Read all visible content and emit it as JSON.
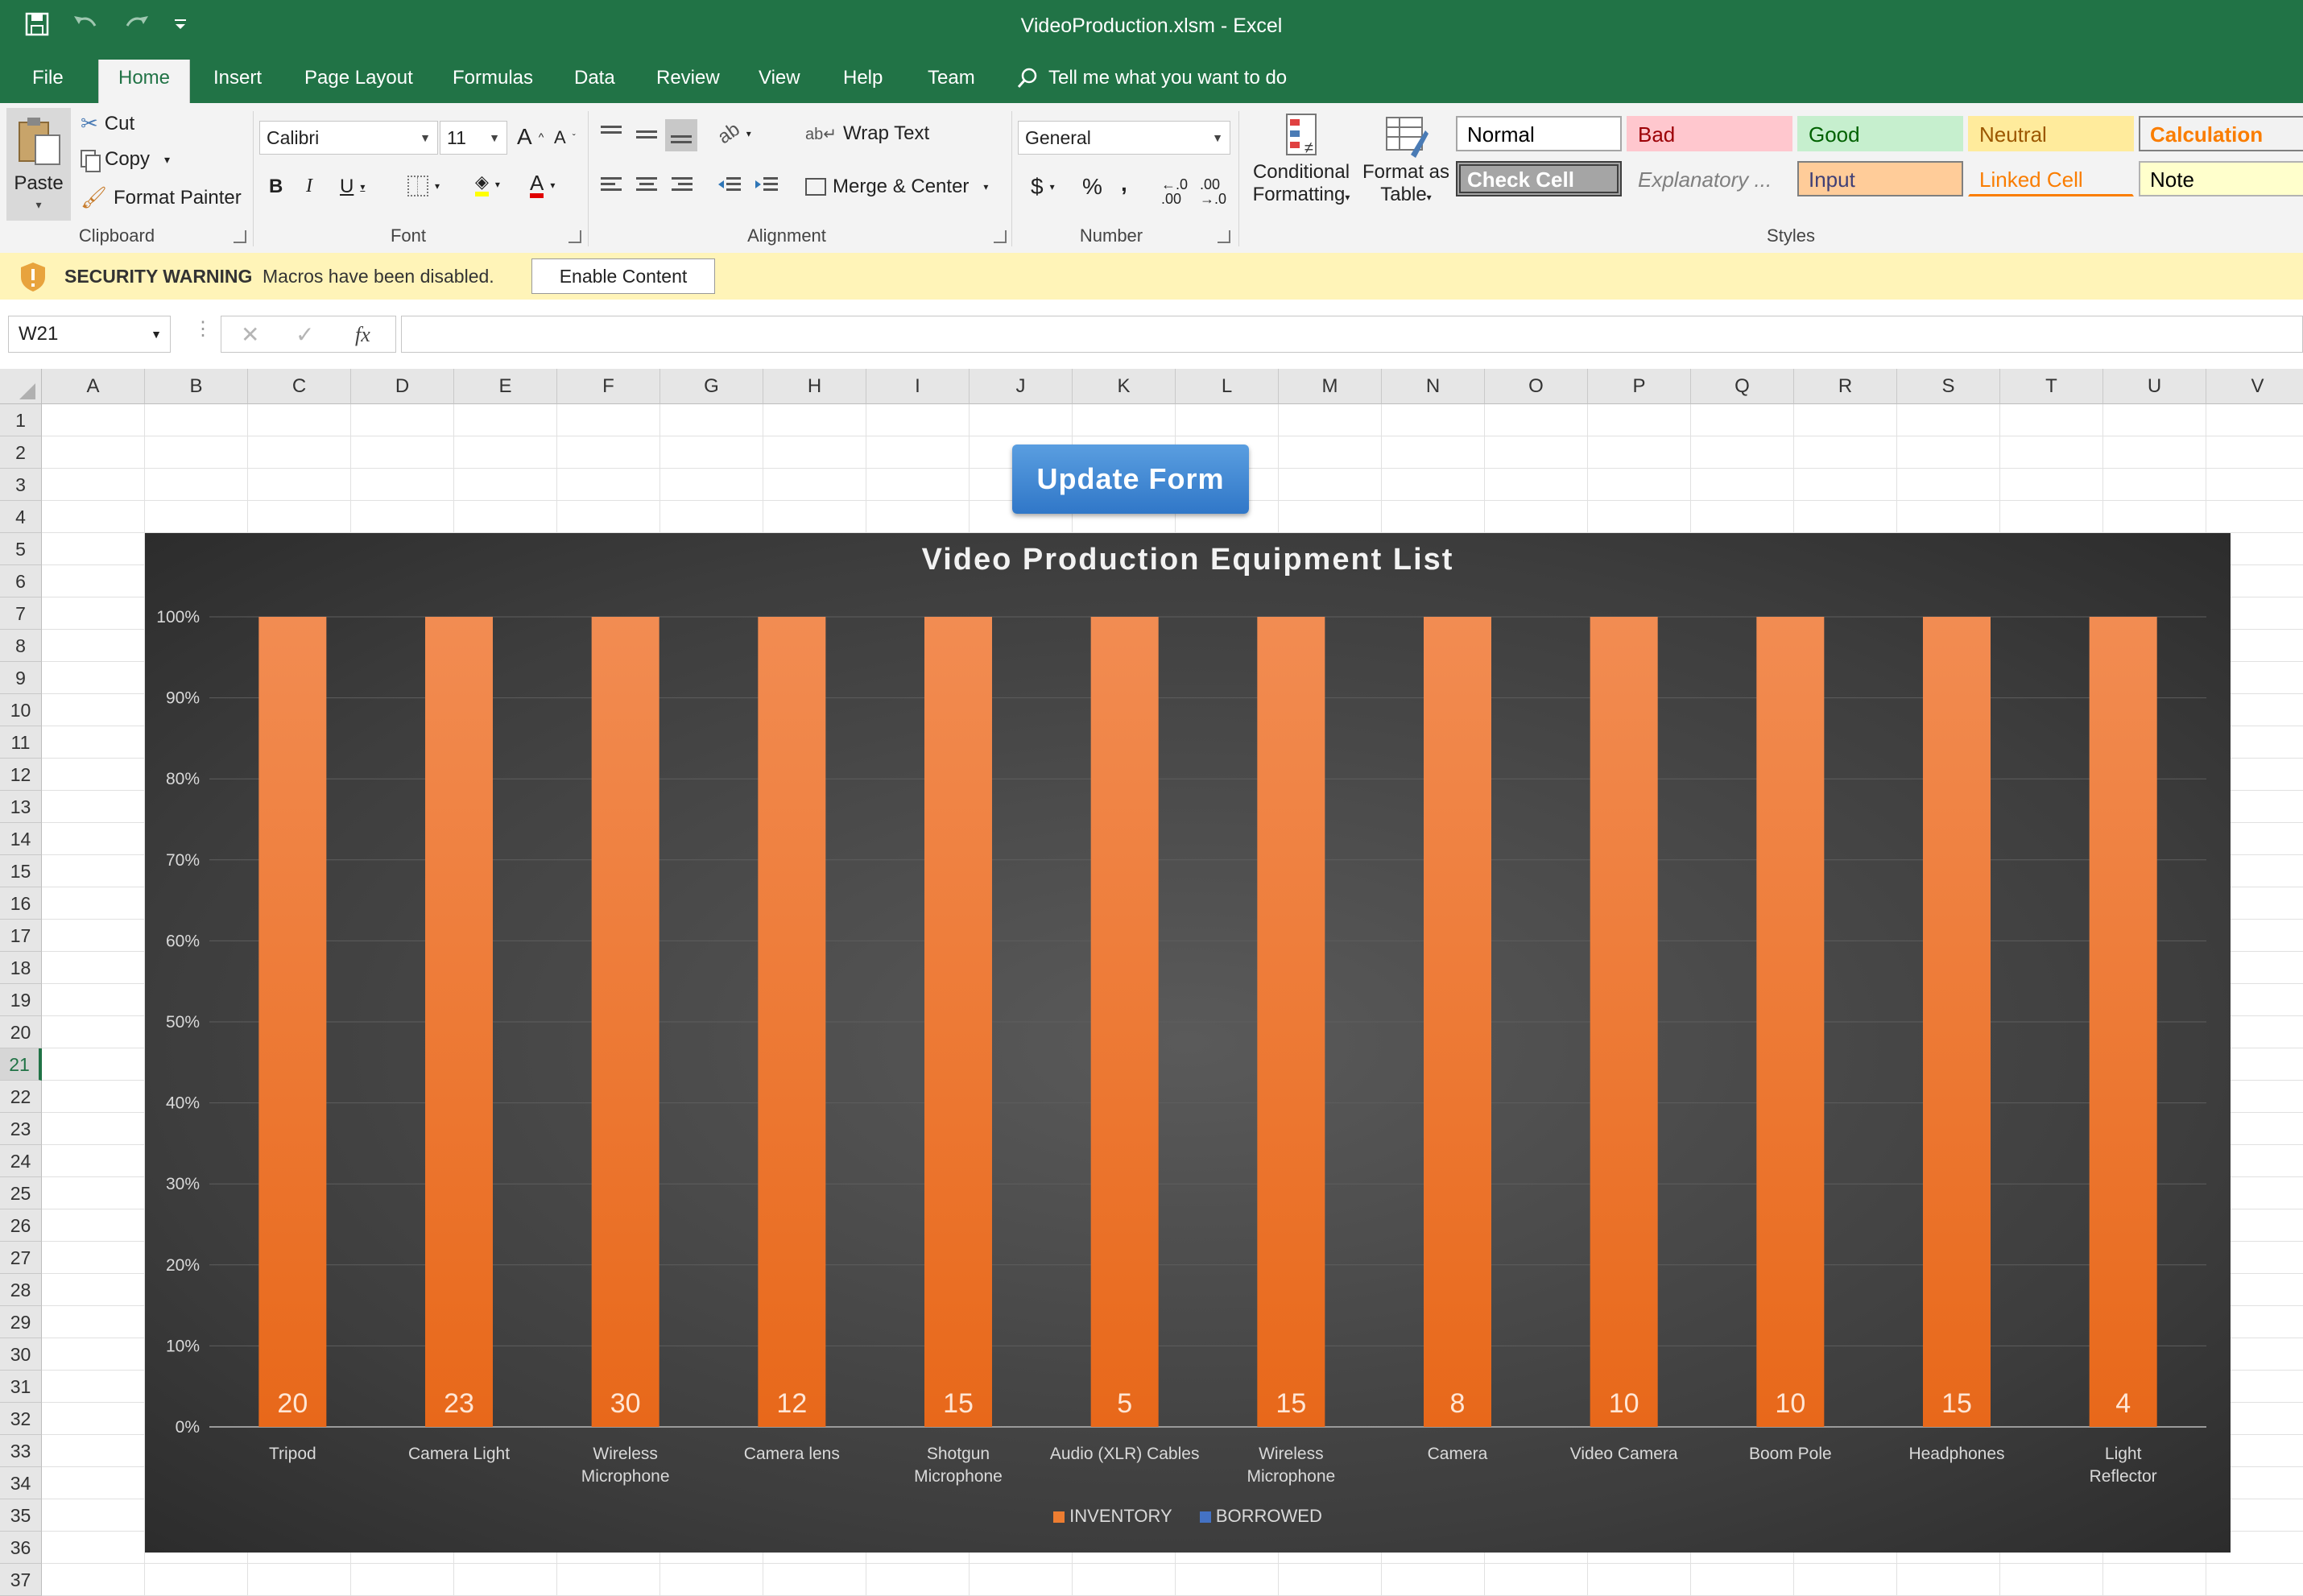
{
  "window": {
    "title": "VideoProduction.xlsm  -  Excel"
  },
  "tabs": [
    "File",
    "Home",
    "Insert",
    "Page Layout",
    "Formulas",
    "Data",
    "Review",
    "View",
    "Help",
    "Team"
  ],
  "tell_me": "Tell me what you want to do",
  "clipboard": {
    "paste": "Paste",
    "cut": "Cut",
    "copy": "Copy",
    "format_painter": "Format Painter",
    "label": "Clipboard"
  },
  "font": {
    "name": "Calibri",
    "size": "11",
    "label": "Font"
  },
  "alignment": {
    "wrap_text": "Wrap Text",
    "merge_center": "Merge & Center",
    "label": "Alignment"
  },
  "number": {
    "format": "General",
    "label": "Number"
  },
  "styles": {
    "conditional": "Conditional",
    "formatting": "Formatting",
    "format_as": "Format as",
    "table": "Table",
    "label": "Styles",
    "cells": [
      {
        "text": "Normal",
        "bg": "#ffffff",
        "color": "#000000",
        "border": "#a6a6a6"
      },
      {
        "text": "Bad",
        "bg": "#ffc7ce",
        "color": "#9c0006",
        "border": "#ffc7ce"
      },
      {
        "text": "Good",
        "bg": "#c6efce",
        "color": "#006100",
        "border": "#c6efce"
      },
      {
        "text": "Neutral",
        "bg": "#ffeb9c",
        "color": "#9c5700",
        "border": "#ffeb9c"
      },
      {
        "text": "Calculation",
        "bg": "#f2f2f2",
        "color": "#fa7d00",
        "border": "#7f7f7f"
      },
      {
        "text": "Check Cell",
        "bg": "#a5a5a5",
        "color": "#ffffff",
        "border": "#3f3f3f"
      },
      {
        "text": "Explanatory ...",
        "bg": "#f3f3f3",
        "color": "#7f7f7f",
        "border": "#f3f3f3"
      },
      {
        "text": "Input",
        "bg": "#ffcc99",
        "color": "#3f3f76",
        "border": "#7f7f7f"
      },
      {
        "text": "Linked Cell",
        "bg": "#f3f3f3",
        "color": "#fa7d00",
        "border": "#f3f3f3"
      },
      {
        "text": "Note",
        "bg": "#ffffcc",
        "color": "#000000",
        "border": "#b2b2b2"
      }
    ]
  },
  "security": {
    "label": "SECURITY WARNING",
    "message": "Macros have been disabled.",
    "button": "Enable Content"
  },
  "formula_bar": {
    "name_box": "W21",
    "fx": "fx",
    "value": ""
  },
  "columns": [
    "A",
    "B",
    "C",
    "D",
    "E",
    "F",
    "G",
    "H",
    "I",
    "J",
    "K",
    "L",
    "M",
    "N",
    "O",
    "P",
    "Q",
    "R",
    "S",
    "T",
    "U",
    "V"
  ],
  "rows": [
    "1",
    "2",
    "3",
    "4",
    "5",
    "6",
    "7",
    "8",
    "9",
    "10",
    "11",
    "12",
    "13",
    "14",
    "15",
    "16",
    "17",
    "18",
    "19",
    "20",
    "21",
    "22",
    "23",
    "24",
    "25",
    "26",
    "27",
    "28",
    "29",
    "30",
    "31",
    "32",
    "33",
    "34",
    "35",
    "36",
    "37"
  ],
  "selected_row": "21",
  "update_button": "Update Form",
  "chart_data": {
    "type": "bar",
    "title": "Video Production Equipment List",
    "categories": [
      "Tripod",
      "Camera Light",
      "Wireless Microphone",
      "Camera lens",
      "Shotgun Microphone",
      "Audio (XLR) Cables",
      "Wireless Microphone",
      "Camera",
      "Video Camera",
      "Boom Pole",
      "Headphones",
      "Light Reflector"
    ],
    "series": [
      {
        "name": "INVENTORY",
        "values": [
          20,
          23,
          30,
          12,
          15,
          5,
          15,
          8,
          10,
          10,
          15,
          4
        ],
        "percent": [
          100,
          100,
          100,
          100,
          100,
          100,
          100,
          100,
          100,
          100,
          100,
          100
        ],
        "color": "#ed7d31"
      },
      {
        "name": "BORROWED",
        "values": [
          0,
          0,
          0,
          0,
          0,
          0,
          0,
          0,
          0,
          0,
          0,
          0
        ],
        "percent": [
          0,
          0,
          0,
          0,
          0,
          0,
          0,
          0,
          0,
          0,
          0,
          0
        ],
        "color": "#4472c4"
      }
    ],
    "y_ticks": [
      "0%",
      "10%",
      "20%",
      "30%",
      "40%",
      "50%",
      "60%",
      "70%",
      "80%",
      "90%",
      "100%"
    ],
    "ylim": [
      0,
      100
    ],
    "stacked": "100%",
    "legend": "bottom",
    "grid": true
  }
}
